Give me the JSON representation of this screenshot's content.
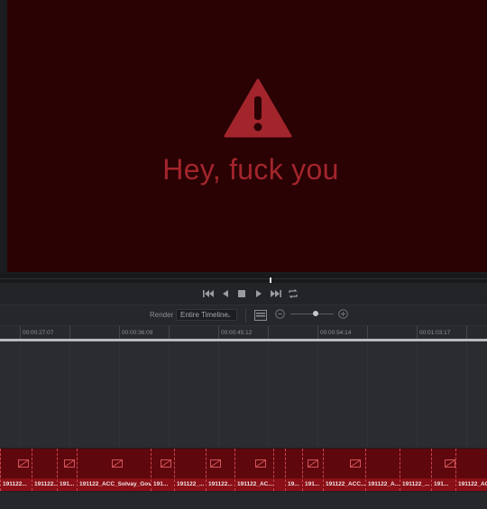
{
  "viewer": {
    "message": "Hey, fuck you",
    "background_color": "#2a0204",
    "accent_color": "#a3252c",
    "icon": "warning-triangle-icon"
  },
  "transport": {
    "buttons": [
      "jump-to-start-icon",
      "play-reverse-icon",
      "stop-icon",
      "play-icon",
      "jump-to-end-icon",
      "loop-icon"
    ]
  },
  "render_bar": {
    "label": "Render",
    "selected": "Entire Timeline"
  },
  "ruler": {
    "timecodes": [
      "00:00:27:07",
      "00:00:36:09",
      "00:00:45:12",
      "00:00:54:14",
      "00:01:03:17"
    ]
  },
  "clips": [
    {
      "label": "191122..."
    },
    {
      "label": "191122..."
    },
    {
      "label": "191..."
    },
    {
      "label": "191122_ACC_Solvay_Gov..."
    },
    {
      "label": "191..."
    },
    {
      "label": "191122_..."
    },
    {
      "label": "191122..."
    },
    {
      "label": "191122_AC..."
    },
    {
      "label": ""
    },
    {
      "label": "19..."
    },
    {
      "label": "191..."
    },
    {
      "label": "191122_ACC..."
    },
    {
      "label": "191122_A..."
    },
    {
      "label": "191122_..."
    },
    {
      "label": "191..."
    },
    {
      "label": "191122_ACC"
    }
  ],
  "clip_color": "#8a0f16"
}
